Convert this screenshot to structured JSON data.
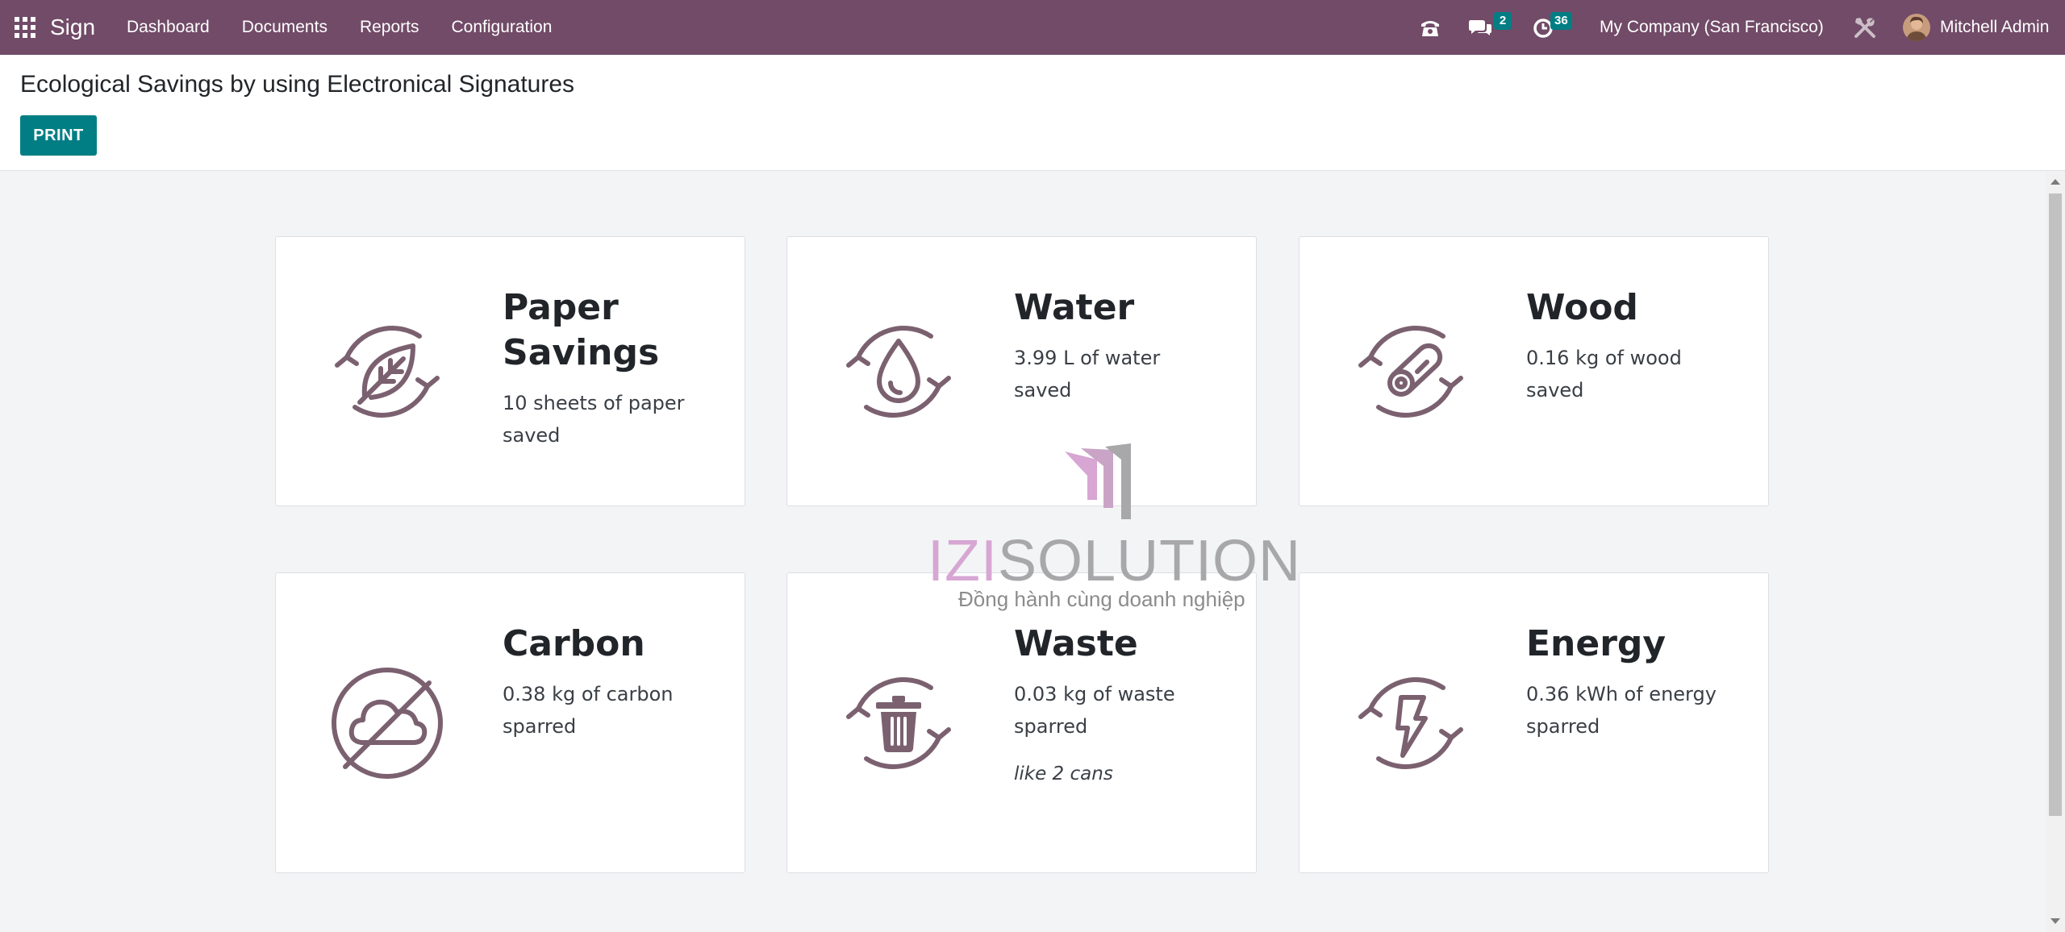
{
  "navbar": {
    "app_name": "Sign",
    "menu": [
      "Dashboard",
      "Documents",
      "Reports",
      "Configuration"
    ],
    "messages_count": "2",
    "activities_count": "36",
    "company": "My Company (San Francisco)",
    "user": "Mitchell Admin"
  },
  "page": {
    "title": "Ecological Savings by using Electronical Signatures",
    "print_label": "PRINT"
  },
  "cards": [
    {
      "title": "Paper Savings",
      "desc": "10 sheets of paper saved",
      "icon": "leaf-recycle-icon"
    },
    {
      "title": "Water",
      "desc": "3.99 L of water saved",
      "icon": "water-drop-recycle-icon"
    },
    {
      "title": "Wood",
      "desc": "0.16 kg of wood saved",
      "icon": "wood-log-recycle-icon"
    },
    {
      "title": "Carbon",
      "desc": "0.38 kg of carbon sparred",
      "icon": "no-cloud-icon"
    },
    {
      "title": "Waste",
      "desc": "0.03 kg of waste sparred",
      "note": "like 2 cans",
      "icon": "trash-recycle-icon"
    },
    {
      "title": "Energy",
      "desc": "0.36 kWh of energy sparred",
      "icon": "lightning-recycle-icon"
    }
  ],
  "watermark": {
    "brand_izi": "IZI",
    "brand_solution": "SOLUTION",
    "tagline": "Đồng hành cùng doanh nghiệp"
  },
  "colors": {
    "navbar": "#714b67",
    "primary_button": "#017e84",
    "icon": "#7b6170",
    "background": "#f3f4f6"
  }
}
